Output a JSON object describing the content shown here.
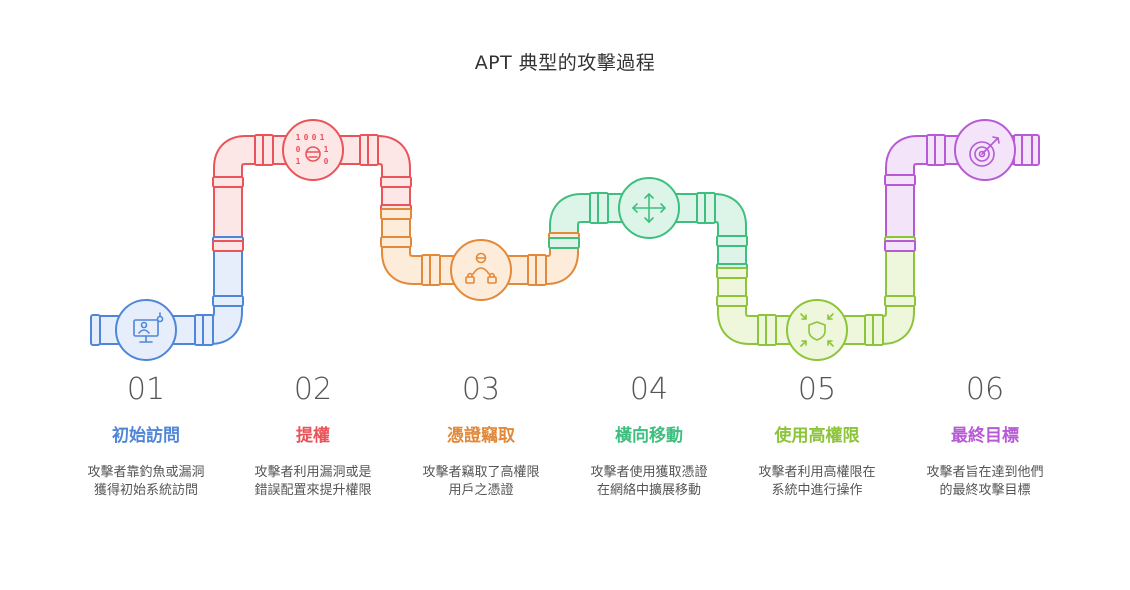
{
  "title": "APT 典型的攻擊過程",
  "steps": [
    {
      "num": "01",
      "label": "初始訪問",
      "desc": "攻擊者靠釣魚或漏洞\n獲得初始系統訪問",
      "color": "#4f86d8",
      "light": "#e6eefb",
      "icon": "monitor-user-icon"
    },
    {
      "num": "02",
      "label": "提權",
      "desc": "攻擊者利用漏洞或是\n錯誤配置來提升權限",
      "color": "#e9545b",
      "light": "#fde6e6",
      "icon": "binary-hacker-icon"
    },
    {
      "num": "03",
      "label": "憑證竊取",
      "desc": "攻擊者竊取了高權限\n用戶之憑證",
      "color": "#e2893a",
      "light": "#fdecd9",
      "icon": "user-lock-icon"
    },
    {
      "num": "04",
      "label": "橫向移動",
      "desc": "攻擊者使用獲取憑證\n在網絡中擴展移動",
      "color": "#3fbf7f",
      "light": "#dcf5e8",
      "icon": "arrows-move-icon"
    },
    {
      "num": "05",
      "label": "使用高權限",
      "desc": "攻擊者利用高權限在\n系統中進行操作",
      "color": "#8cc43a",
      "light": "#eef7dc",
      "icon": "shield-inward-icon"
    },
    {
      "num": "06",
      "label": "最終目標",
      "desc": "攻擊者旨在達到他們\n的最終攻擊目標",
      "color": "#b65ad6",
      "light": "#f4e4fa",
      "icon": "target-arrow-icon"
    }
  ],
  "binary_digits": [
    "1",
    "0",
    "0",
    "1",
    "0",
    "1",
    "1",
    "0"
  ]
}
